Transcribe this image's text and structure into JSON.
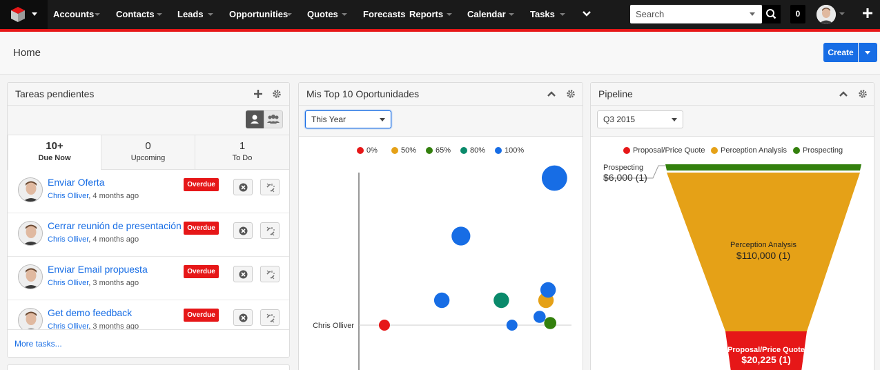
{
  "nav": {
    "items": [
      {
        "label": "Accounts",
        "has_caret": true
      },
      {
        "label": "Contacts",
        "has_caret": true
      },
      {
        "label": "Leads",
        "has_caret": true
      },
      {
        "label": "Opportunities",
        "has_caret": true
      },
      {
        "label": "Quotes",
        "has_caret": true
      },
      {
        "label": "Forecasts",
        "has_caret": false
      },
      {
        "label": "Reports",
        "has_caret": true
      },
      {
        "label": "Calendar",
        "has_caret": true
      },
      {
        "label": "Tasks",
        "has_caret": true
      }
    ],
    "more_icon": "chevron-down-icon",
    "search_placeholder": "Search",
    "notification_count": "0",
    "plus_icon": "plus-icon"
  },
  "header": {
    "title": "Home",
    "create_label": "Create"
  },
  "tasks": {
    "title": "Tareas pendientes",
    "tabs": [
      {
        "count": "10+",
        "label": "Due Now",
        "active": true
      },
      {
        "count": "0",
        "label": "Upcoming",
        "active": false
      },
      {
        "count": "1",
        "label": "To Do",
        "active": false
      }
    ],
    "rows": [
      {
        "title": "Enviar Oferta",
        "user": "Chris Olliver",
        "time": ", 4 months ago",
        "badge": "Overdue"
      },
      {
        "title": "Cerrar reunión de presentación",
        "user": "Chris Olliver",
        "time": ", 4 months ago",
        "badge": "Overdue"
      },
      {
        "title": "Enviar Email propuesta",
        "user": "Chris Olliver",
        "time": ", 3 months ago",
        "badge": "Overdue"
      },
      {
        "title": "Get demo feedback",
        "user": "Chris Olliver",
        "time": ", 3 months ago",
        "badge": "Overdue"
      }
    ],
    "more_label": "More tasks..."
  },
  "top10": {
    "title": "Mis Top 10 Oportunidades",
    "filter_value": "This Year"
  },
  "pipeline": {
    "title": "Pipeline",
    "filter_value": "Q3 2015"
  },
  "chart_data": [
    {
      "type": "scatter",
      "title": "",
      "legend": [
        {
          "name": "0%",
          "color": "#e61718"
        },
        {
          "name": "50%",
          "color": "#e5a117"
        },
        {
          "name": "65%",
          "color": "#33800d"
        },
        {
          "name": "80%",
          "color": "#0a8a6b"
        },
        {
          "name": "100%",
          "color": "#176de5"
        }
      ],
      "legend_position": "top",
      "y_categories": [
        "Chris Olliver"
      ],
      "points": [
        {
          "series": "0%",
          "x": 0.12,
          "y": 0.0,
          "size": 1
        },
        {
          "series": "100%",
          "x": 0.39,
          "y": 0.6,
          "size": 1.4
        },
        {
          "series": "100%",
          "x": 0.48,
          "y": 2.15,
          "size": 1.7
        },
        {
          "series": "80%",
          "x": 0.67,
          "y": 0.6,
          "size": 1.4
        },
        {
          "series": "100%",
          "x": 0.72,
          "y": 0.0,
          "size": 1
        },
        {
          "series": "100%",
          "x": 0.85,
          "y": 0.2,
          "size": 1.1
        },
        {
          "series": "50%",
          "x": 0.88,
          "y": 0.6,
          "size": 1.4
        },
        {
          "series": "100%",
          "x": 0.89,
          "y": 0.85,
          "size": 1.4
        },
        {
          "series": "65%",
          "x": 0.9,
          "y": 0.05,
          "size": 1.1
        },
        {
          "series": "100%",
          "x": 0.92,
          "y": 3.55,
          "size": 2.3
        }
      ]
    },
    {
      "type": "funnel",
      "title": "",
      "legend": [
        {
          "name": "Proposal/Price Quote",
          "color": "#e61718"
        },
        {
          "name": "Perception Analysis",
          "color": "#e5a117"
        },
        {
          "name": "Prospecting",
          "color": "#33800d"
        }
      ],
      "legend_position": "top",
      "stages": [
        {
          "name": "Prospecting",
          "value": 6000,
          "label_value": "$6,000 (1)",
          "color": "#33800d"
        },
        {
          "name": "Perception Analysis",
          "value": 110000,
          "label_value": "$110,000 (1)",
          "color": "#e5a117"
        },
        {
          "name": "Proposal/Price Quote",
          "value": 20225,
          "label_value": "$20,225 (1)",
          "color": "#e61718"
        }
      ]
    }
  ]
}
